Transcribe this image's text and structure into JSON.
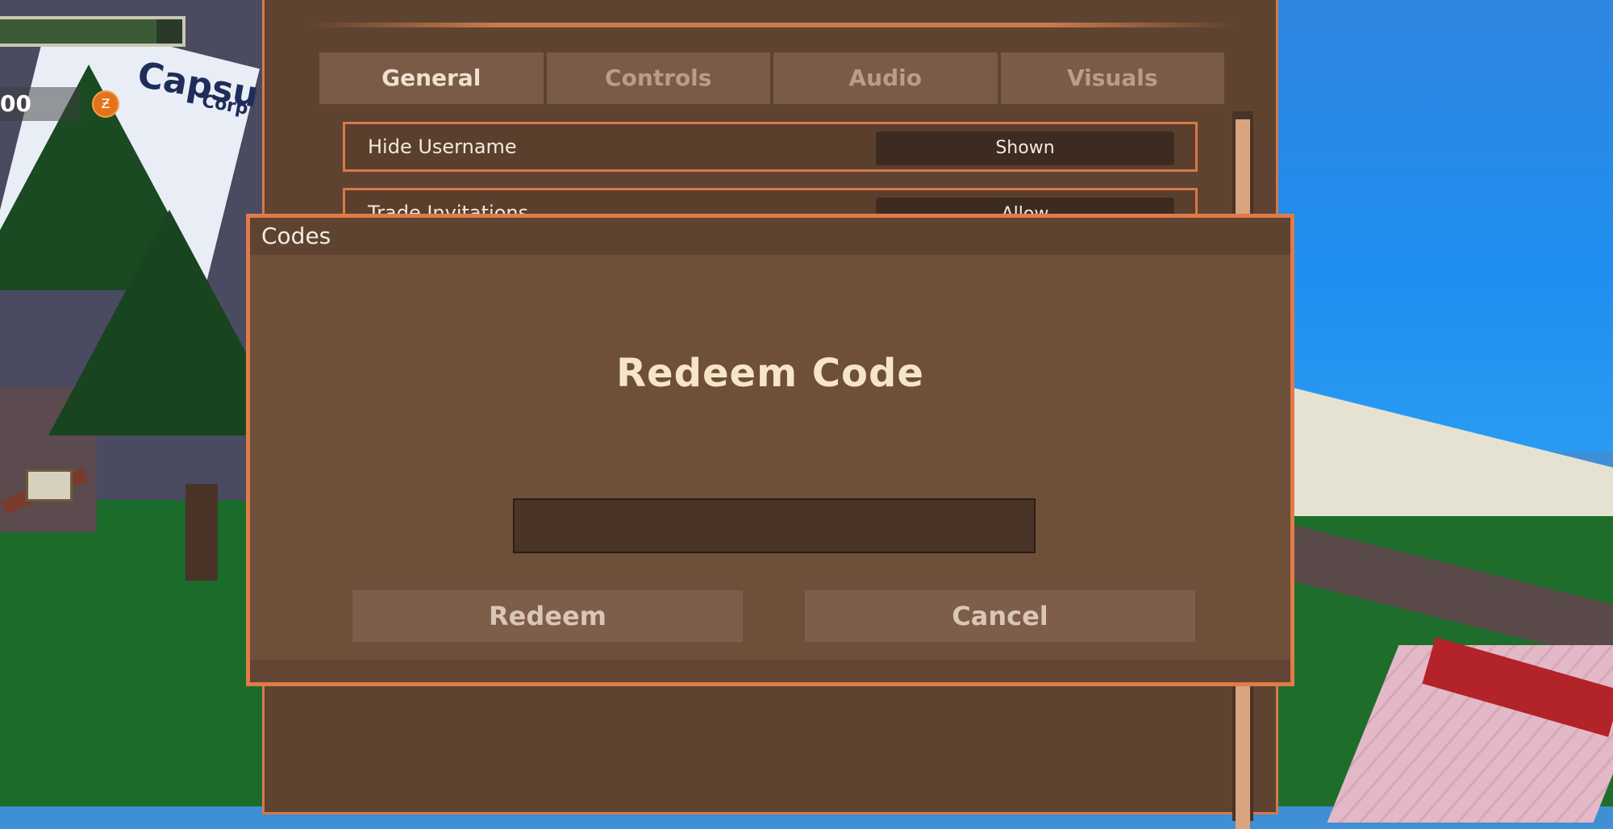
{
  "hud": {
    "money": "00",
    "coins": "0",
    "coin_icon": "zeni-coin-icon"
  },
  "world": {
    "building_sign": "Capsu",
    "building_sub": "Corp"
  },
  "settings": {
    "tabs": [
      {
        "label": "General",
        "active": true
      },
      {
        "label": "Controls",
        "active": false
      },
      {
        "label": "Audio",
        "active": false
      },
      {
        "label": "Visuals",
        "active": false
      }
    ],
    "rows": [
      {
        "label": "Hide Username",
        "value": "Shown"
      },
      {
        "label": "Trade Invitations",
        "value": "Allow"
      }
    ]
  },
  "codes_modal": {
    "title": "Codes",
    "heading": "Redeem Code",
    "input_value": "",
    "input_placeholder": "",
    "redeem_label": "Redeem",
    "cancel_label": "Cancel"
  },
  "colors": {
    "accent_border": "#e07b49",
    "panel_bg": "#6e4f39",
    "heading_text": "#f7e6c6"
  }
}
